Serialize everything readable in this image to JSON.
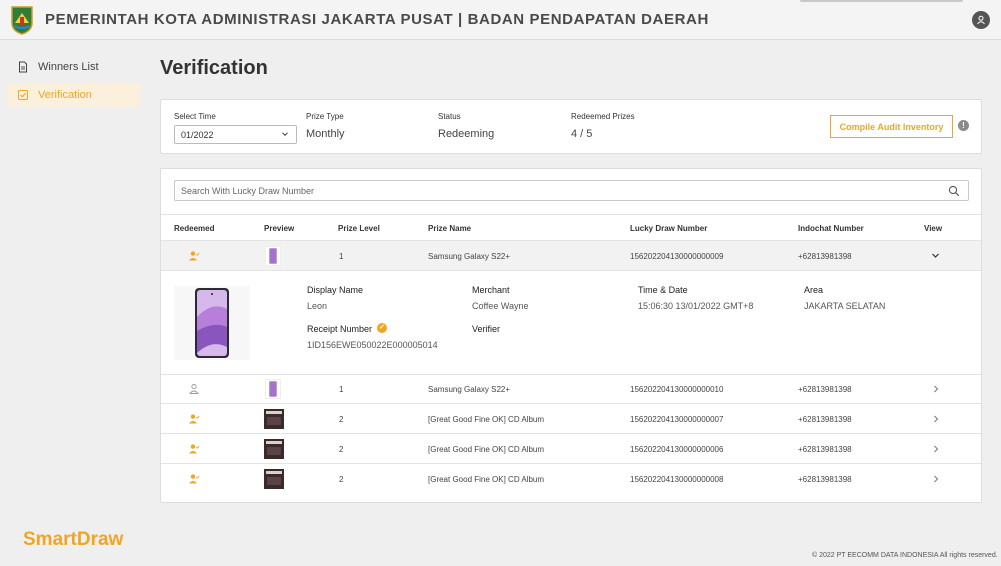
{
  "header": {
    "title": "PEMERINTAH KOTA ADMINISTRASI JAKARTA PUSAT | BADAN PENDAPATAN DAERAH",
    "crest_icon": "city-crest",
    "account_icon": "user-icon"
  },
  "sidebar": {
    "items": [
      {
        "label": "Winners List",
        "icon": "document-icon",
        "active": false
      },
      {
        "label": "Verification",
        "icon": "checkbox-icon",
        "active": true
      }
    ]
  },
  "brand": "SmartDraw",
  "copyright": "© 2022 PT EECOMM DATA INDONESIA All rights reserved.",
  "page_title": "Verification",
  "filters": {
    "select_time": {
      "label": "Select Time",
      "value": "01/2022"
    },
    "prize_type": {
      "label": "Prize Type",
      "value": "Monthly"
    },
    "status": {
      "label": "Status",
      "value": "Redeeming"
    },
    "redeemed_prizes": {
      "label": "Redeemed Prizes",
      "value": "4 / 5"
    },
    "compile_button": "Compile Audit Inventory",
    "info": "!"
  },
  "search": {
    "placeholder": "Search With Lucky Draw Number"
  },
  "columns": [
    "Redeemed",
    "Preview",
    "Prize Level",
    "Prize Name",
    "Lucky Draw Number",
    "Indochat Number",
    "View"
  ],
  "rows": [
    {
      "redeemed": true,
      "preview": "phone",
      "level": "1",
      "name": "Samsung Galaxy S22+",
      "lucky": "156202204130000000009",
      "indochat": "+62813981398",
      "expanded": true
    },
    {
      "redeemed": false,
      "preview": "phone",
      "level": "1",
      "name": "Samsung Galaxy S22+",
      "lucky": "156202204130000000010",
      "indochat": "+62813981398",
      "expanded": false
    },
    {
      "redeemed": true,
      "preview": "album",
      "level": "2",
      "name": "[Great Good Fine OK] CD Album",
      "lucky": "156202204130000000007",
      "indochat": "+62813981398",
      "expanded": false
    },
    {
      "redeemed": true,
      "preview": "album",
      "level": "2",
      "name": "[Great Good Fine OK] CD Album",
      "lucky": "156202204130000000006",
      "indochat": "+62813981398",
      "expanded": false
    },
    {
      "redeemed": true,
      "preview": "album",
      "level": "2",
      "name": "[Great Good Fine OK] CD Album",
      "lucky": "156202204130000000008",
      "indochat": "+62813981398",
      "expanded": false
    }
  ],
  "detail": {
    "display_name": {
      "label": "Display Name",
      "value": "Leon"
    },
    "merchant": {
      "label": "Merchant",
      "value": "Coffee Wayne"
    },
    "time_date": {
      "label": "Time & Date",
      "value": "15:06:30 13/01/2022 GMT+8"
    },
    "area": {
      "label": "Area",
      "value": "JAKARTA SELATAN"
    },
    "receipt_number": {
      "label": "Receipt Number",
      "value": "1ID156EWE050022E000005014",
      "verified": true
    },
    "verifier": {
      "label": "Verifier",
      "value": ""
    }
  },
  "colors": {
    "accent": "#f0a623",
    "background": "#efefef",
    "card": "#ffffff"
  }
}
